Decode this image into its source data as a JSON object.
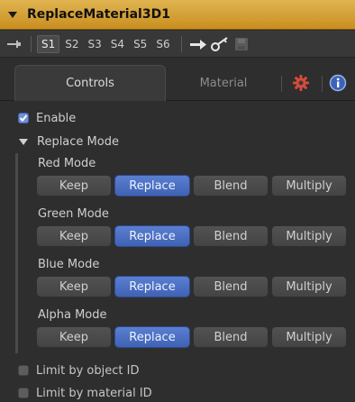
{
  "header": {
    "title": "ReplaceMaterial3D1"
  },
  "toolbar": {
    "scenes": [
      "S1",
      "S2",
      "S3",
      "S4",
      "S5",
      "S6"
    ],
    "active_scene": "S1"
  },
  "tabs": {
    "controls": "Controls",
    "material": "Material"
  },
  "enable": {
    "label": "Enable",
    "checked": true
  },
  "replace_mode": {
    "label": "Replace Mode"
  },
  "modes": {
    "options": [
      "Keep",
      "Replace",
      "Blend",
      "Multiply"
    ],
    "selected": "Replace",
    "red": "Red Mode",
    "green": "Green Mode",
    "blue": "Blue Mode",
    "alpha": "Alpha Mode"
  },
  "limit_object": {
    "label": "Limit by object ID",
    "checked": false
  },
  "limit_material": {
    "label": "Limit by material ID",
    "checked": false
  },
  "colors": {
    "title_bar": "#d9a43a",
    "selected_button": "#4a6fc6",
    "panel": "#2e2e2e"
  }
}
